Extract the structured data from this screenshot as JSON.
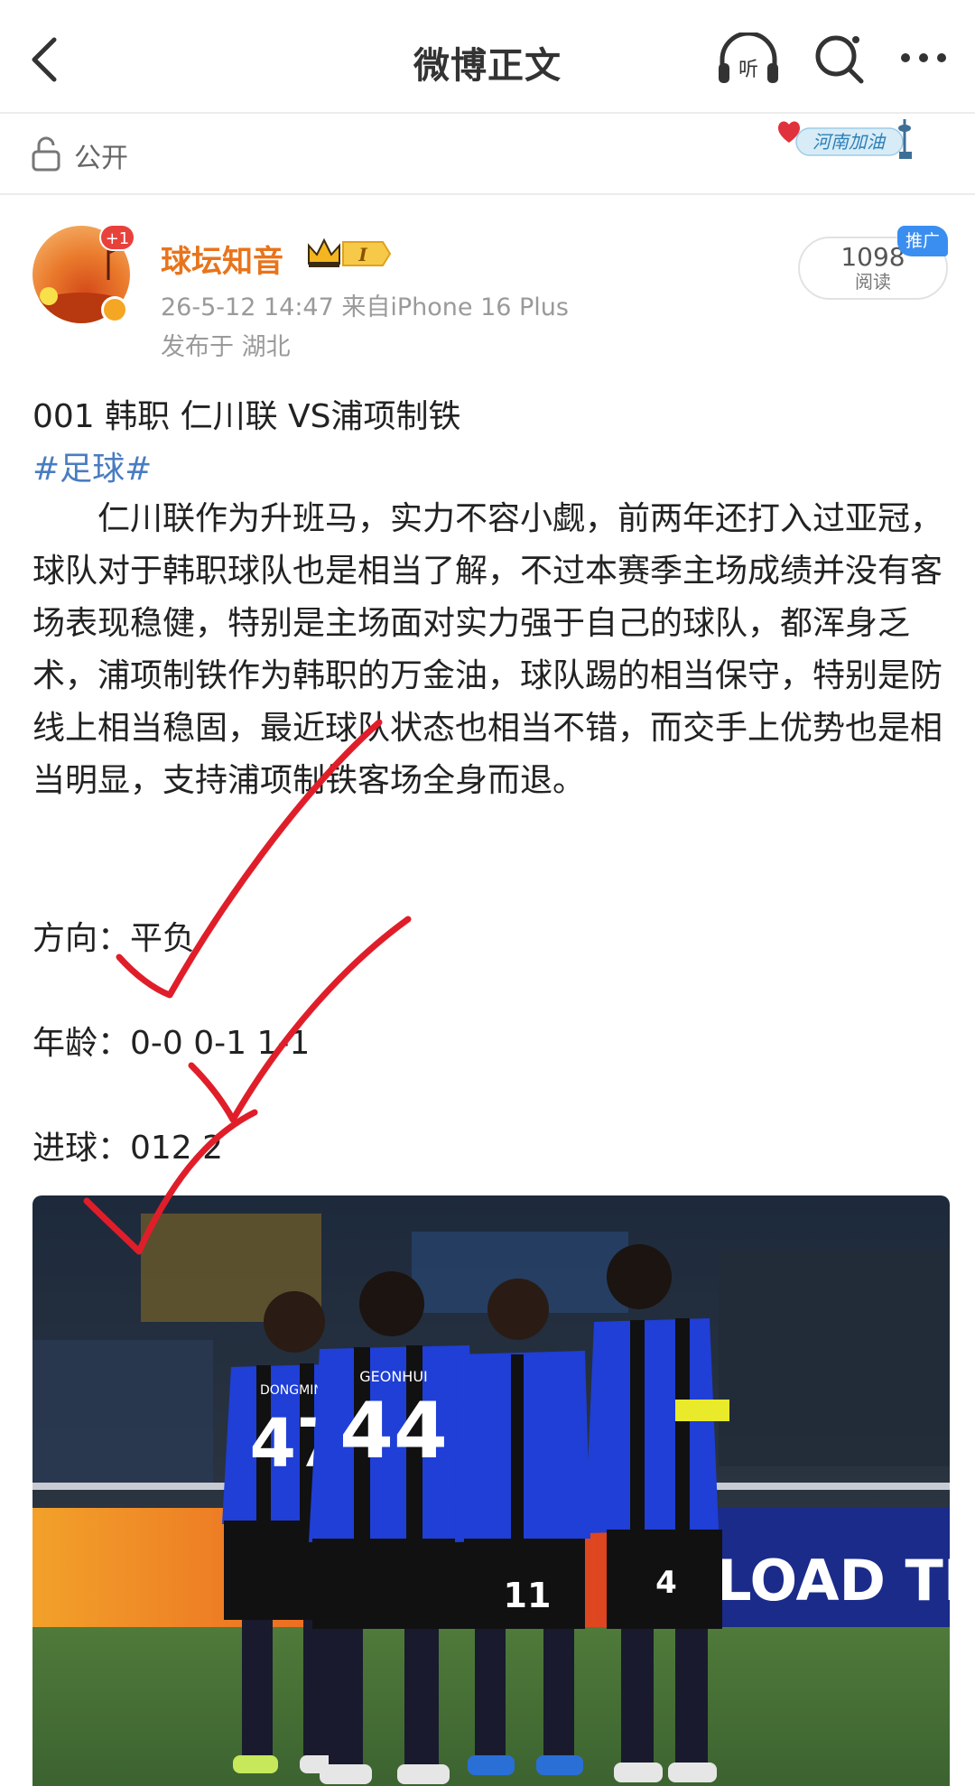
{
  "nav": {
    "title": "微博正文",
    "icons": [
      "back-icon",
      "listen-icon",
      "search-icon",
      "more-icon"
    ],
    "listen_glyph": "听"
  },
  "visibility": {
    "label": "公开",
    "badge_text": "河南加油"
  },
  "author": {
    "name": "球坛知音",
    "avatar_badge": "+1",
    "level_badge": "I",
    "meta": "26-5-12 14:47  来自iPhone 16 Plus",
    "location": "发布于 湖北",
    "read_count": "1098",
    "read_label": "阅读",
    "promo_tag": "推广"
  },
  "post": {
    "title": "001 韩职 仁川联 VS浦项制铁",
    "topic": "#足球#",
    "body": "仁川联作为升班马，实力不容小觑，前两年还打入过亚冠，球队对于韩职球队也是相当了解，不过本赛季主场成绩并没有客场表现稳健，特别是主场面对实力强于自己的球队，都浑身乏术，浦项制铁作为韩职的万金油，球队踢的相当保守，特别是防线上相当稳固，最近球队状态也相当不错，而交手上优势也是相当明显，支持浦项制铁客场全身而退。",
    "direction": "方向：平负",
    "score": "年龄：0-0 0-1 1-1",
    "goals": "进球：012 2"
  },
  "photo": {
    "jersey_numbers": [
      "47",
      "44",
      "11",
      "4"
    ],
    "jersey_names": [
      "DONGMIN",
      "GEONHUI"
    ],
    "board_text": "WNLOAD THE"
  },
  "colors": {
    "accent_orange": "#e8741c",
    "topic_blue": "#4a7cc0",
    "promo_blue": "#3a8ef0",
    "check_red": "#e01e2a",
    "kit_blue": "#1f3fd6"
  }
}
